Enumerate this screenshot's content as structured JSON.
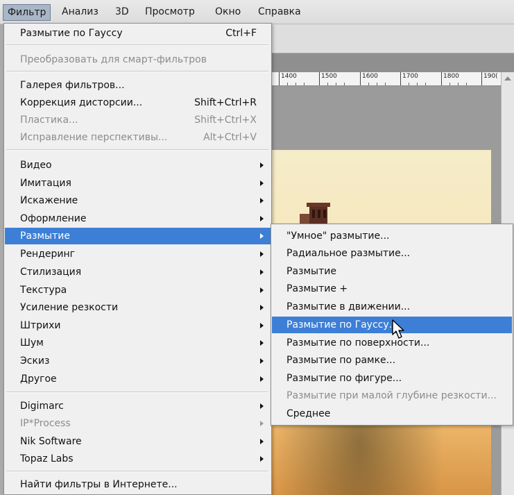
{
  "menubar": {
    "items": [
      "Фильтр",
      "Анализ",
      "3D",
      "Просмотр",
      "Окно",
      "Справка"
    ]
  },
  "ruler": {
    "labels": [
      "1400",
      "1500",
      "1600",
      "1700",
      "1800",
      "190("
    ]
  },
  "filter_menu": {
    "last_filter": {
      "label": "Размытие по Гауссу",
      "shortcut": "Ctrl+F"
    },
    "convert_smart": "Преобразовать для смарт-фильтров",
    "filter_gallery": "Галерея фильтров...",
    "lens_correction": {
      "label": "Коррекция дисторсии...",
      "shortcut": "Shift+Ctrl+R"
    },
    "liquify": {
      "label": "Пластика...",
      "shortcut": "Shift+Ctrl+X"
    },
    "vanishing_point": {
      "label": "Исправление перспективы...",
      "shortcut": "Alt+Ctrl+V"
    },
    "groups": [
      "Видео",
      "Имитация",
      "Искажение",
      "Оформление",
      "Размытие",
      "Рендеринг",
      "Стилизация",
      "Текстура",
      "Усиление резкости",
      "Штрихи",
      "Шум",
      "Эскиз",
      "Другое"
    ],
    "plugins": [
      "Digimarc",
      "IP*Process",
      "Nik Software",
      "Topaz Labs"
    ],
    "browse_online": "Найти фильтры в Интернете..."
  },
  "blur_submenu": {
    "items": [
      "\"Умное\" размытие...",
      "Радиальное размытие...",
      "Размытие",
      "Размытие +",
      "Размытие в движении...",
      "Размытие по Гауссу...",
      "Размытие по поверхности...",
      "Размытие по рамке...",
      "Размытие по фигуре...",
      "Размытие при малой глубине резкости...",
      "Среднее"
    ]
  },
  "colors": {
    "selection": "#3d7fd6",
    "menu_bg": "#f0f0f0",
    "disabled_text": "#8c8c8c"
  }
}
